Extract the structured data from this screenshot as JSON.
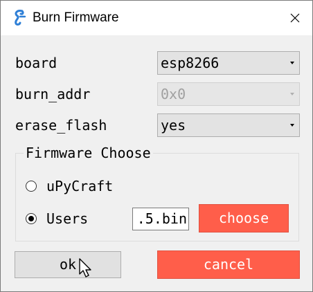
{
  "window": {
    "title": "Burn Firmware",
    "icon": "snake-logo-icon"
  },
  "fields": {
    "board": {
      "label": "board",
      "value": "esp8266"
    },
    "burn_addr": {
      "label": "burn_addr",
      "value": "0x0",
      "disabled": true
    },
    "erase_flash": {
      "label": "erase_flash",
      "value": "yes"
    }
  },
  "firmware_group": {
    "title": "Firmware Choose",
    "options": [
      {
        "label": "uPyCraft",
        "selected": false
      },
      {
        "label": "Users",
        "selected": true
      }
    ],
    "path_value": ".5.bin",
    "choose_label": "choose"
  },
  "buttons": {
    "ok": "ok",
    "cancel": "cancel"
  },
  "colors": {
    "accent": "#ff5e4a",
    "background": "#f0f0f0",
    "logo": "#2e7fd6"
  }
}
